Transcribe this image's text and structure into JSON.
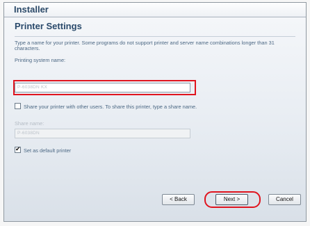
{
  "window": {
    "title": "Installer"
  },
  "page": {
    "heading": "Printer Settings",
    "description": "Type a name for your printer. Some programs do not support printer and server name combinations longer than 31 characters.",
    "printing_system_name_label": "Printing system name:",
    "printing_system_name_value": "P-6038DN KX",
    "share_checkbox": {
      "checked": false,
      "label": "Share your printer with other users. To share this printer, type a share name."
    },
    "share_name_label": "Share name:",
    "share_name_value": "P-6038DN",
    "default_checkbox": {
      "checked": true,
      "label": "Set as default printer",
      "mark": "✔"
    }
  },
  "buttons": {
    "back": "< Back",
    "next": "Next >",
    "cancel": "Cancel"
  },
  "colors": {
    "highlight": "#e0141e",
    "title_text": "#2b4968",
    "body_text": "#4c6884"
  }
}
